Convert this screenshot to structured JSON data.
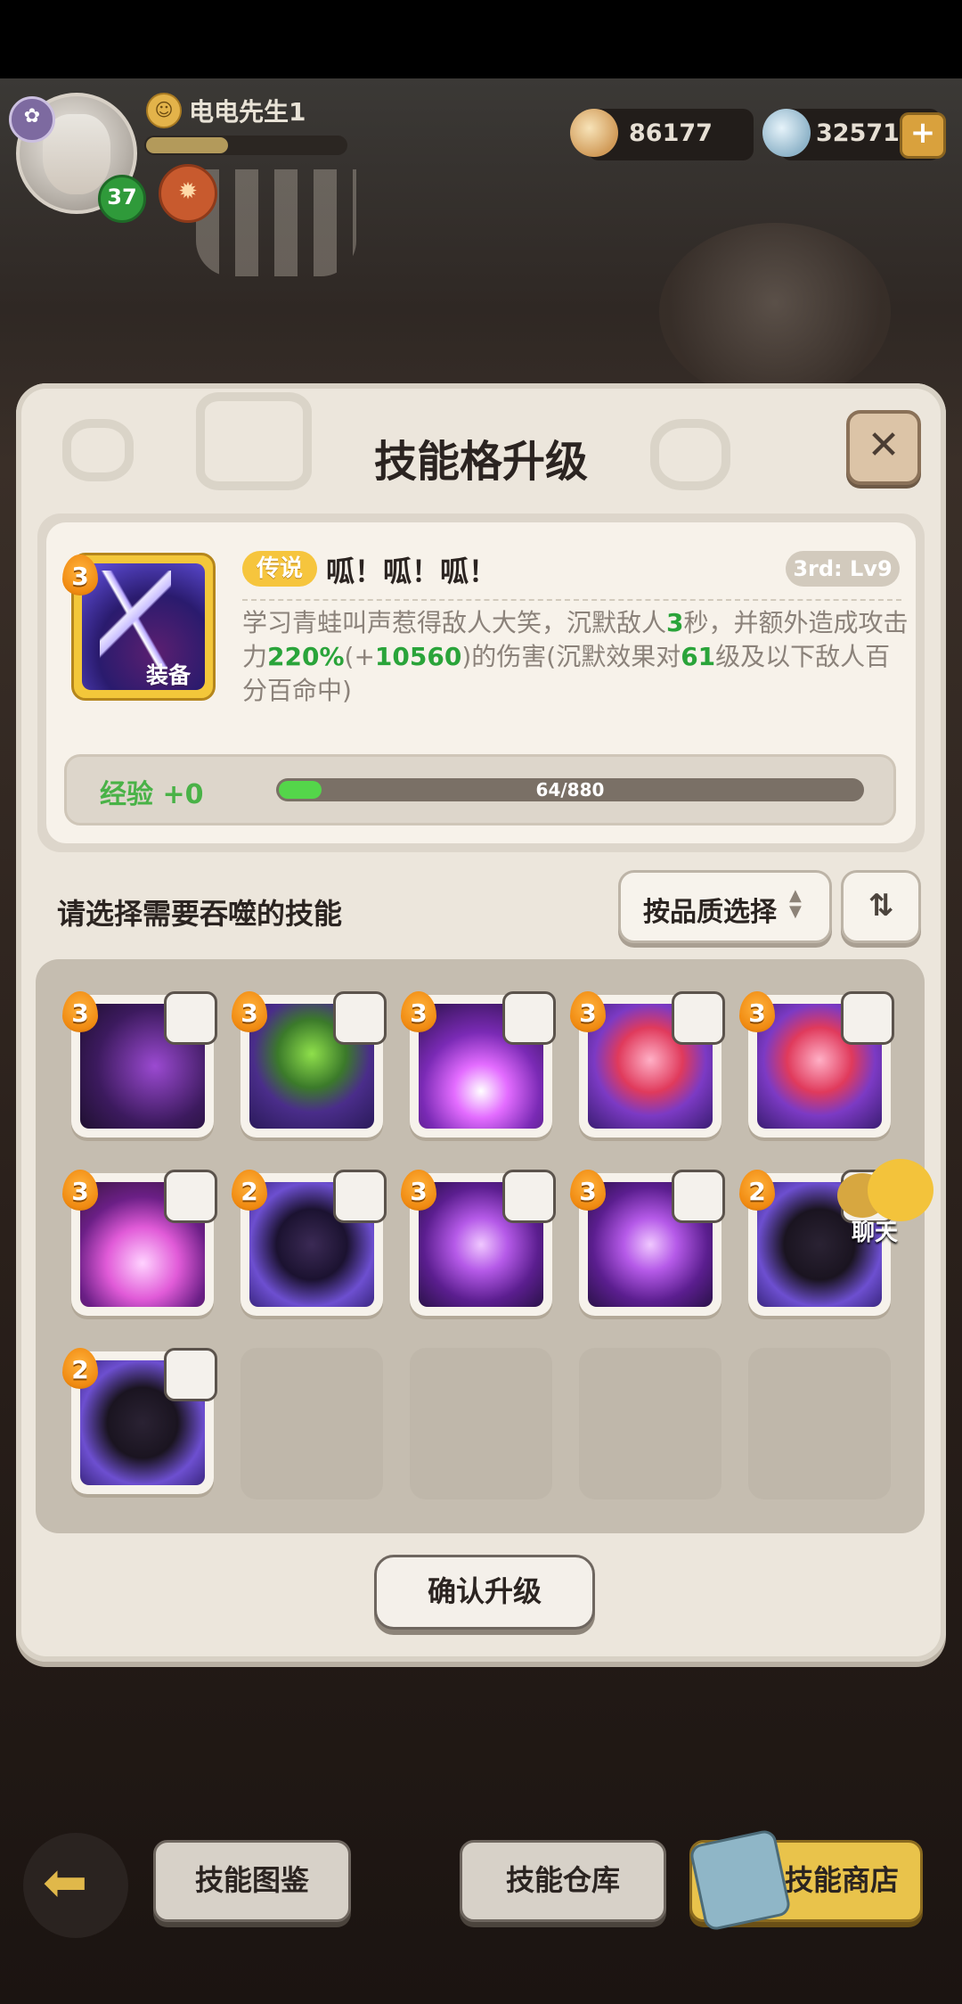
{
  "header": {
    "player_name": "电电先生1",
    "level": "37",
    "currency_1": "86177",
    "currency_2": "325714",
    "add_icon": "plus-icon"
  },
  "dialog": {
    "title": "技能格升级",
    "close_icon": "close-icon",
    "skill": {
      "rarity": "传说",
      "name": "呱！呱！呱！",
      "level": "3rd: Lv9",
      "tier": "3",
      "equip_tag": "装备",
      "desc_parts": [
        "学习青蛙叫声惹得敌人大笑，沉默敌人",
        "3",
        "秒，并额外造成攻击力",
        "220%",
        "(+",
        "10560",
        ")的伤害(沉默效果对",
        "61",
        "级及以下敌人百分百命中)"
      ]
    },
    "exp": {
      "label": "经验",
      "gain": "+0",
      "progress_text": "64/880",
      "progress_fraction": 0.0727
    },
    "select_label": "请选择需要吞噬的技能",
    "sort_label": "按品质选择",
    "confirm_label": "确认升级"
  },
  "skill_grid": [
    {
      "tier": "3",
      "art": "purple-blade"
    },
    {
      "tier": "3",
      "art": "green-frog"
    },
    {
      "tier": "3",
      "art": "purple-burst"
    },
    {
      "tier": "3",
      "art": "red-frog"
    },
    {
      "tier": "3",
      "art": "red-frog"
    },
    {
      "tier": "3",
      "art": "pink-fire"
    },
    {
      "tier": "2",
      "art": "dark-frog"
    },
    {
      "tier": "3",
      "art": "purple-flame"
    },
    {
      "tier": "3",
      "art": "purple-flame"
    },
    {
      "tier": "2",
      "art": "black-frog"
    },
    {
      "tier": "2",
      "art": "black-frog"
    }
  ],
  "chat": {
    "label": "聊天"
  },
  "bottom_nav": {
    "back_icon": "back-arrow-icon",
    "codex": "技能图鉴",
    "storage": "技能仓库",
    "shop": "技能商店"
  },
  "colors": {
    "accent_green": "#2aa43a",
    "legend_gold": "#f6c53d",
    "tier_orange": "#f08a11"
  }
}
